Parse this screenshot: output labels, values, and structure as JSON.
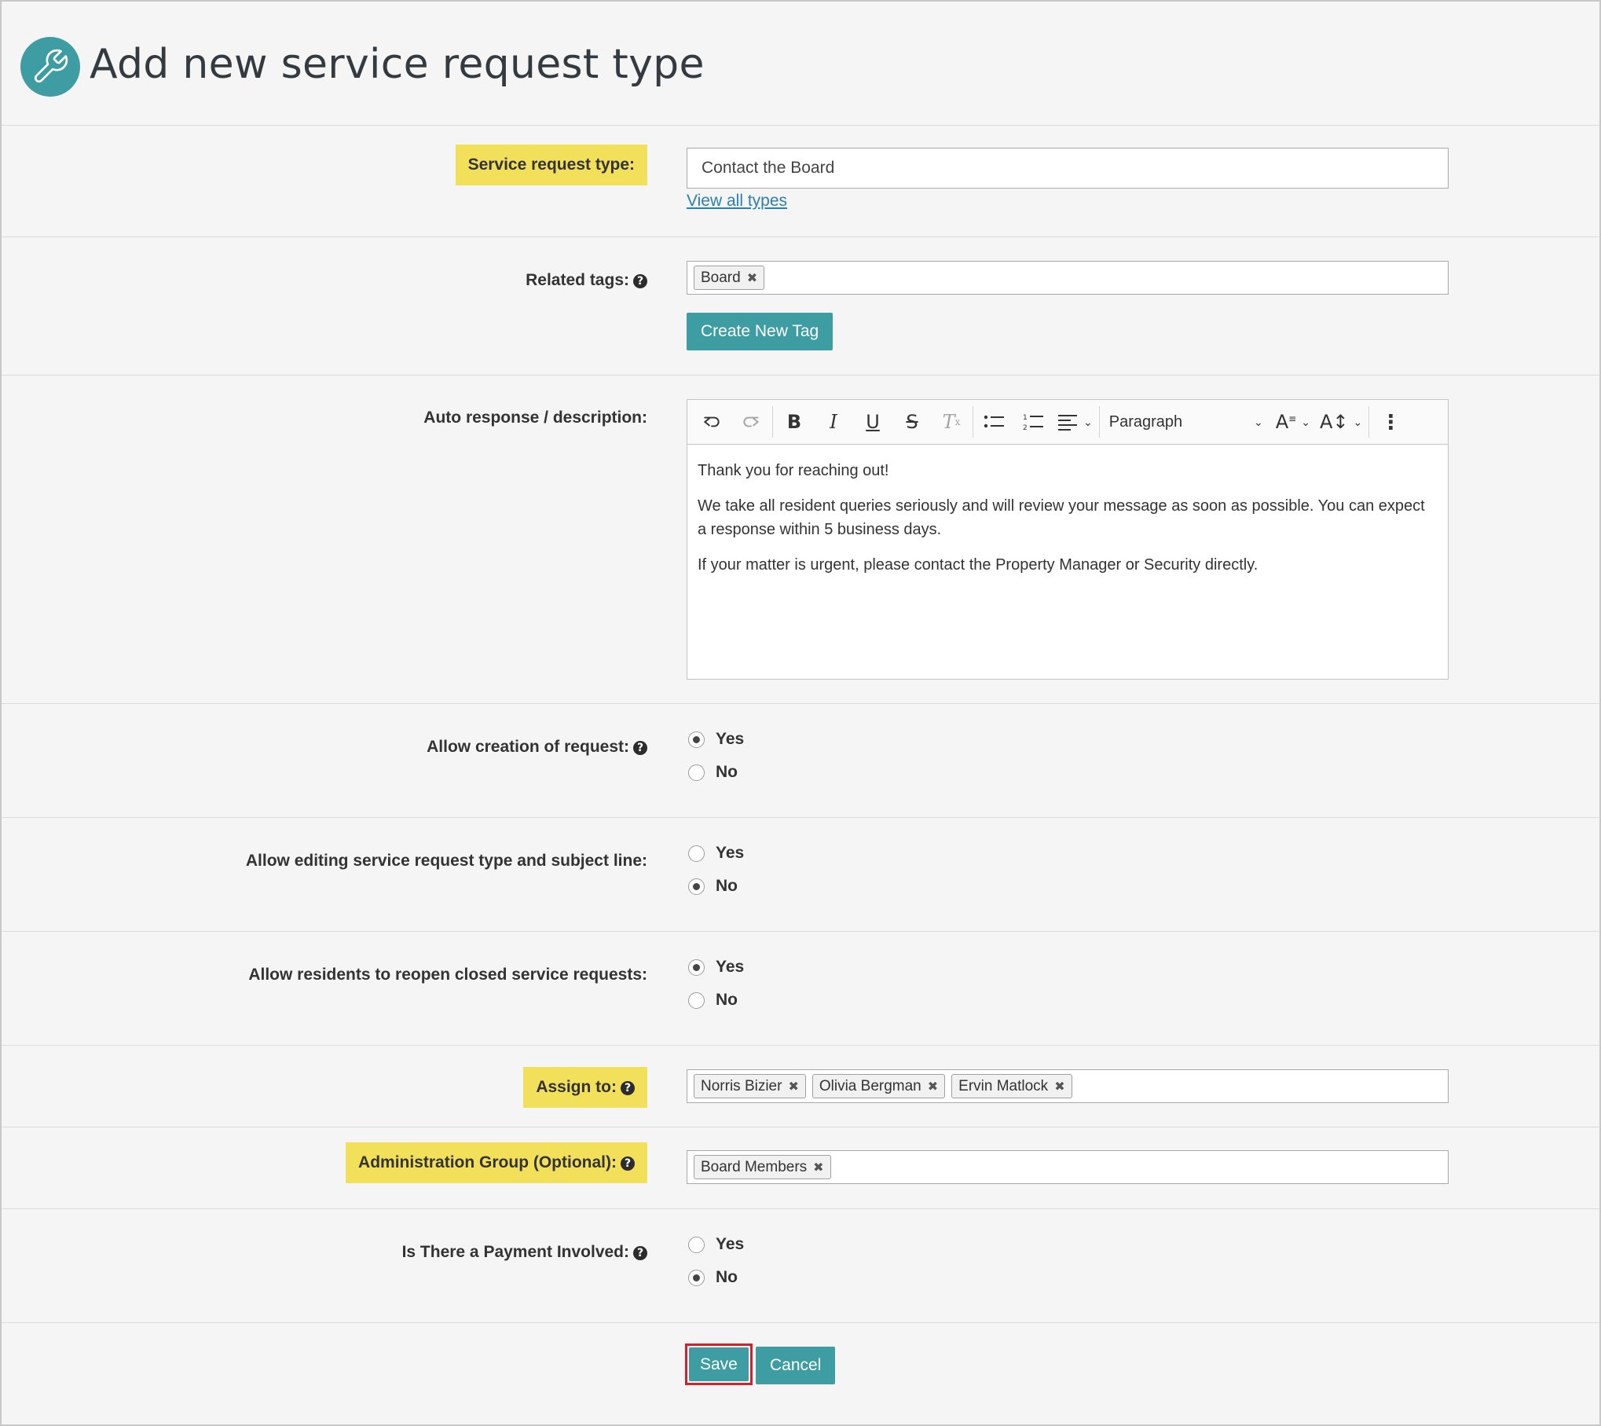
{
  "header": {
    "title": "Add new service request type",
    "icon": "wrench-icon",
    "accent": "#3d9da3"
  },
  "service_request_type": {
    "label": "Service request type:",
    "value": "Contact the Board",
    "link": "View all types"
  },
  "related_tags": {
    "label": "Related tags:",
    "tags": [
      "Board"
    ],
    "create_button": "Create New Tag"
  },
  "auto_response": {
    "label": "Auto response / description:",
    "toolbar": {
      "block_format": "Paragraph"
    },
    "paragraphs": [
      "Thank you for reaching out!",
      "We take all resident queries seriously and will review your message as soon as possible. You can expect a response within 5 business days.",
      "If your matter is urgent, please contact the Property Manager or Security directly."
    ]
  },
  "allow_creation": {
    "label": "Allow creation of request:",
    "yes": "Yes",
    "no": "No",
    "selected": "Yes"
  },
  "allow_editing": {
    "label": "Allow editing service request type and subject line:",
    "yes": "Yes",
    "no": "No",
    "selected": "No"
  },
  "allow_reopen": {
    "label": "Allow residents to reopen closed service requests:",
    "yes": "Yes",
    "no": "No",
    "selected": "Yes"
  },
  "assign_to": {
    "label": "Assign to:",
    "tags": [
      "Norris Bizier",
      "Olivia Bergman",
      "Ervin Matlock"
    ]
  },
  "admin_group": {
    "label": "Administration Group (Optional):",
    "tags": [
      "Board Members"
    ]
  },
  "payment": {
    "label": "Is There a Payment Involved:",
    "yes": "Yes",
    "no": "No",
    "selected": "No"
  },
  "actions": {
    "save": "Save",
    "cancel": "Cancel"
  },
  "colors": {
    "highlight": "#f3e05a",
    "button": "#3d9da3",
    "save_outline": "#d2202c"
  }
}
